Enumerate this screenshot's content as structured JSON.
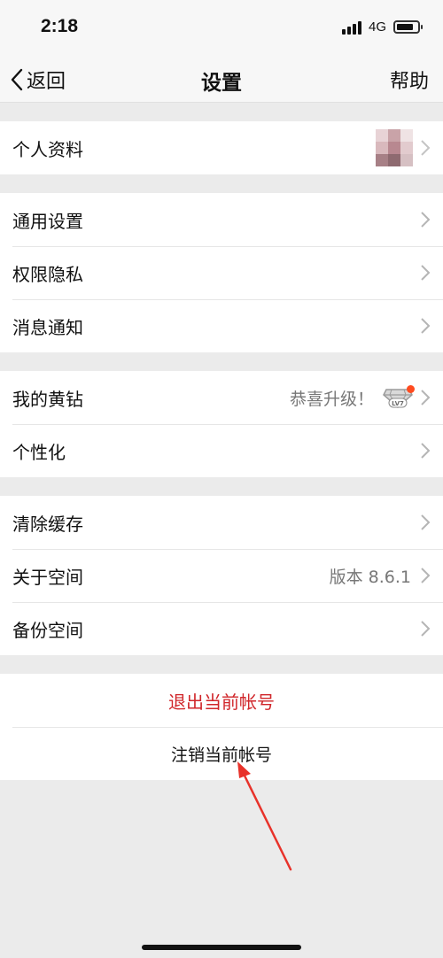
{
  "status_bar": {
    "time": "2:18",
    "network": "4G"
  },
  "nav": {
    "back_label": "返回",
    "title": "设置",
    "help_label": "帮助"
  },
  "groups": [
    {
      "rows": [
        {
          "label": "个人资料"
        }
      ]
    },
    {
      "rows": [
        {
          "label": "通用设置"
        },
        {
          "label": "权限隐私"
        },
        {
          "label": "消息通知"
        }
      ]
    },
    {
      "rows": [
        {
          "label": "我的黄钻",
          "value": "恭喜升级！",
          "badge": "LV7"
        },
        {
          "label": "个性化"
        }
      ]
    },
    {
      "rows": [
        {
          "label": "清除缓存"
        },
        {
          "label": "关于空间",
          "value": "版本 8.6.1"
        },
        {
          "label": "备份空间"
        }
      ]
    }
  ],
  "actions": {
    "logout": "退出当前帐号",
    "cancel": "注销当前帐号"
  },
  "colors": {
    "accent_red": "#d0262a",
    "annotation_arrow": "#e8322a",
    "badge_dot": "#ff4b1f"
  }
}
